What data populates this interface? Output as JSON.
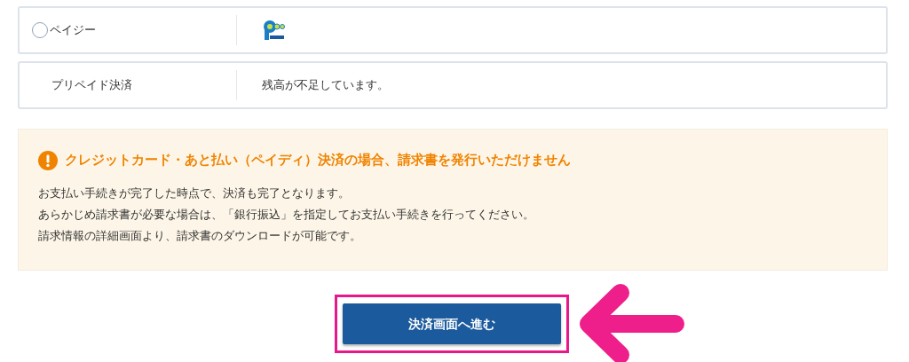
{
  "payment_methods": [
    {
      "kind": "radio",
      "label": "ペイジー",
      "selected": false,
      "detail": {
        "kind": "logo"
      }
    },
    {
      "kind": "plain",
      "label": "プリペイド決済",
      "detail": {
        "kind": "text",
        "text": "残高が不足しています。"
      }
    }
  ],
  "notice": {
    "title": "クレジットカード・あと払い（ペイディ）決済の場合、請求書を発行いただけません",
    "lines": [
      "お支払い手続きが完了した時点で、決済も完了となります。",
      "あらかじめ請求書が必要な場合は、「銀行振込」を指定してお支払い手続きを行ってください。",
      "請求情報の詳細画面より、請求書のダウンロードが可能です。"
    ]
  },
  "submit_button": {
    "label": "決済画面へ進む"
  }
}
